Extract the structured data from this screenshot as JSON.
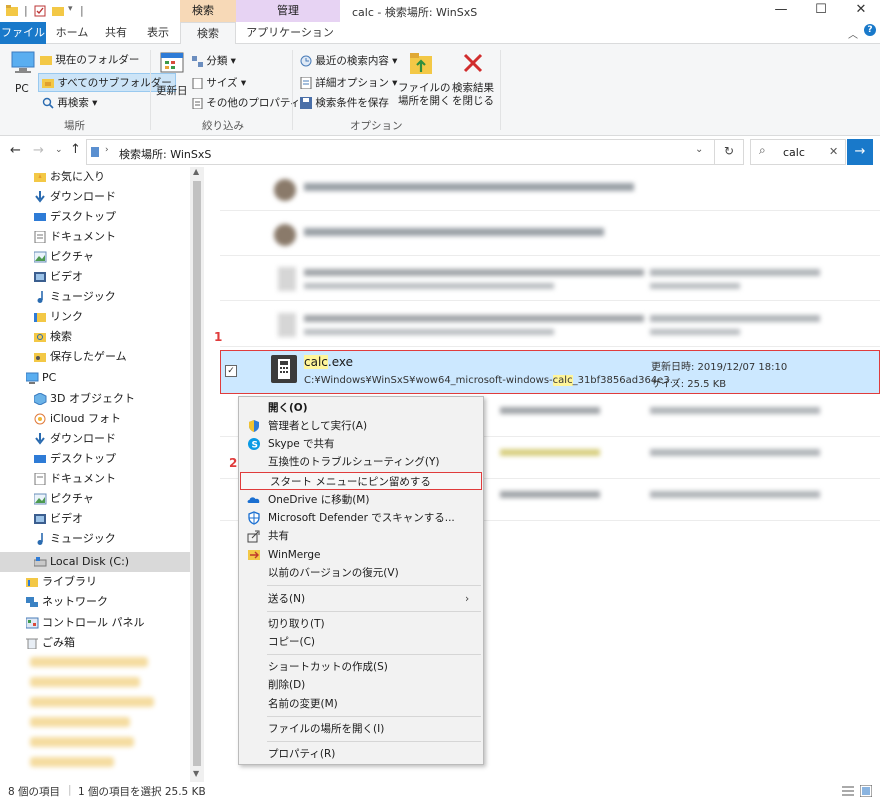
{
  "window": {
    "title": "calc - 検索場所: WinSxS",
    "context_search_tools": "検索ツール",
    "context_manage": "管理"
  },
  "tabs": {
    "file": "ファイル",
    "home": "ホーム",
    "share": "共有",
    "view": "表示",
    "search": "検索",
    "app_tools": "アプリケーション ツール"
  },
  "ribbon": {
    "pc": "PC",
    "current_folder": "現在のフォルダー",
    "all_subfolders": "すべてのサブフォルダー",
    "search_again": "再検索 ▾",
    "group_location": "場所",
    "date_modified": "更新日",
    "kind": "分類 ▾",
    "size": "サイズ ▾",
    "other_props": "その他のプロパティ ▾",
    "group_refine": "絞り込み",
    "recent_searches": "最近の検索内容 ▾",
    "advanced_options": "詳細オプション ▾",
    "save_search": "検索条件を保存",
    "open_location_l1": "ファイルの",
    "open_location_l2": "場所を開く",
    "close_search_l1": "検索結果",
    "close_search_l2": "を閉じる",
    "group_options": "オプション"
  },
  "address": {
    "path": "検索場所: WinSxS",
    "search_value": "calc"
  },
  "nav": {
    "items": [
      {
        "label": "お気に入り"
      },
      {
        "label": "ダウンロード"
      },
      {
        "label": "デスクトップ"
      },
      {
        "label": "ドキュメント"
      },
      {
        "label": "ピクチャ"
      },
      {
        "label": "ビデオ"
      },
      {
        "label": "ミュージック"
      },
      {
        "label": "リンク"
      },
      {
        "label": "検索"
      },
      {
        "label": "保存したゲーム"
      },
      {
        "label": "PC"
      },
      {
        "label": "3D オブジェクト"
      },
      {
        "label": "iCloud フォト"
      },
      {
        "label": "ダウンロード"
      },
      {
        "label": "デスクトップ"
      },
      {
        "label": "ドキュメント"
      },
      {
        "label": "ピクチャ"
      },
      {
        "label": "ビデオ"
      },
      {
        "label": "ミュージック"
      },
      {
        "label": "Local Disk (C:)"
      },
      {
        "label": "ライブラリ"
      },
      {
        "label": "ネットワーク"
      },
      {
        "label": "コントロール パネル"
      },
      {
        "label": "ごみ箱"
      }
    ]
  },
  "selected_file": {
    "name_hl": "calc",
    "name_rest": ".exe",
    "path_pre": "C:¥Windows¥WinSxS¥wow64_microsoft-windows-",
    "path_hl": "calc",
    "path_post": "_31bf3856ad364e3...",
    "modified": "更新日時: 2019/12/07 18:10",
    "size": "サイズ: 25.5 KB"
  },
  "annotations": {
    "one": "1",
    "two": "2"
  },
  "context_menu": {
    "items": [
      "開く(O)",
      "管理者として実行(A)",
      "Skype で共有",
      "互換性のトラブルシューティング(Y)",
      "スタート メニューにピン留めする",
      "OneDrive に移動(M)",
      "Microsoft Defender でスキャンする...",
      "共有",
      "WinMerge",
      "以前のバージョンの復元(V)",
      "送る(N)",
      "切り取り(T)",
      "コピー(C)",
      "ショートカットの作成(S)",
      "削除(D)",
      "名前の変更(M)",
      "ファイルの場所を開く(I)",
      "プロパティ(R)"
    ]
  },
  "status": {
    "count": "8 個の項目",
    "selected": "1 個の項目を選択  25.5 KB"
  },
  "colors": {
    "accent": "#1979ca",
    "highlight_red": "#e03c3c",
    "selection": "#cce8ff"
  }
}
